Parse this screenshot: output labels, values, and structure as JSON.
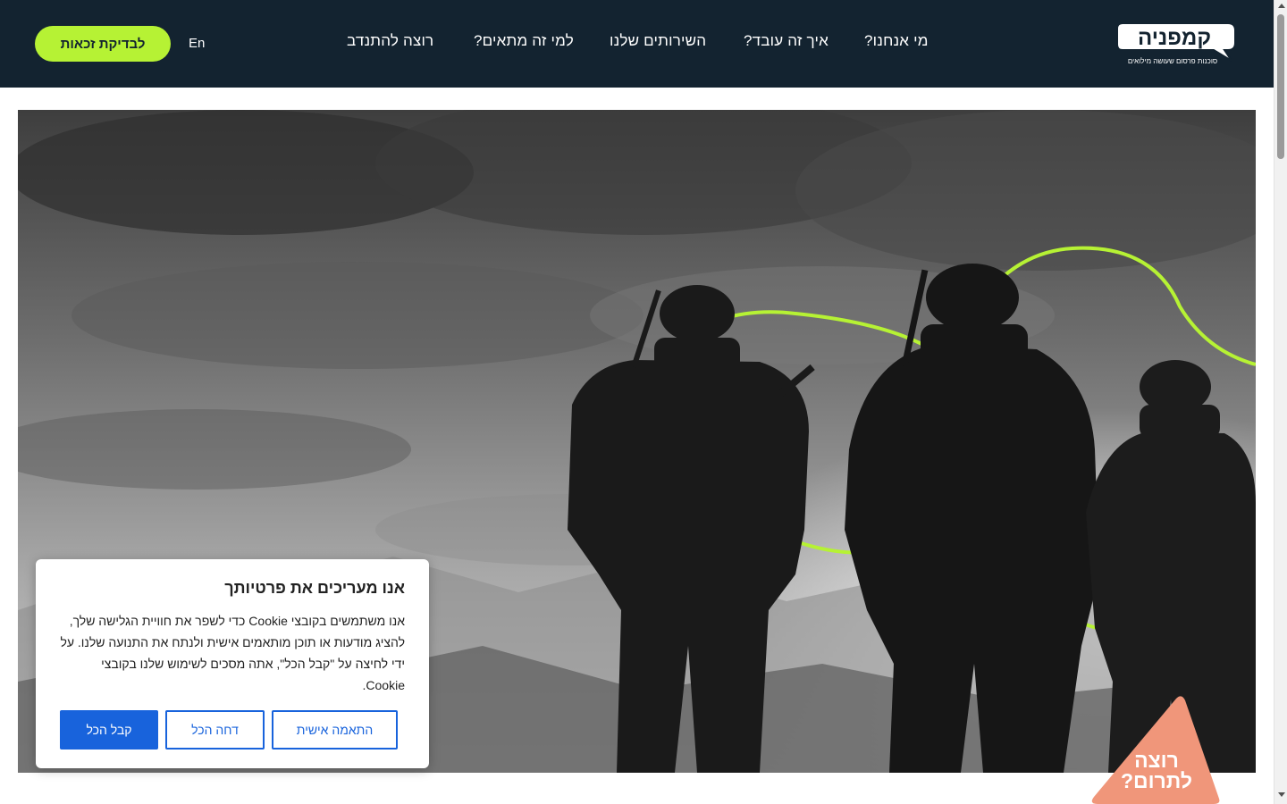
{
  "header": {
    "logo": {
      "text": "קמפניה",
      "tagline": "סוכנות פרסום שעושה מילואים"
    },
    "nav": [
      {
        "label": "מי אנחנו?"
      },
      {
        "label": "איך זה עובד?"
      },
      {
        "label": "השירותים שלנו"
      },
      {
        "label": "למי זה מתאים?"
      },
      {
        "label": "רוצה להתנדב"
      }
    ],
    "lang_label": "En",
    "cta_label": "לבדיקת זכאות"
  },
  "cookie": {
    "title": "אנו מעריכים את פרטיותך",
    "text": "אנו משתמשים בקובצי Cookie כדי לשפר את חוויית הגלישה שלך, להציג מודעות או תוכן מותאמים אישית ולנתח את התנועה שלנו. על ידי לחיצה על \"קבל הכל\", אתה מסכים לשימוש שלנו בקובצי Cookie.",
    "buttons": {
      "customize": "התאמה אישית",
      "reject": "דחה הכל",
      "accept": "קבל הכל"
    }
  },
  "donate": {
    "line1": "רוצה",
    "line2": "לתרום?"
  },
  "colors": {
    "header_bg": "#132330",
    "accent_green": "#b6f234",
    "cookie_blue": "#1863dc",
    "donate_orange": "#f0967a"
  }
}
